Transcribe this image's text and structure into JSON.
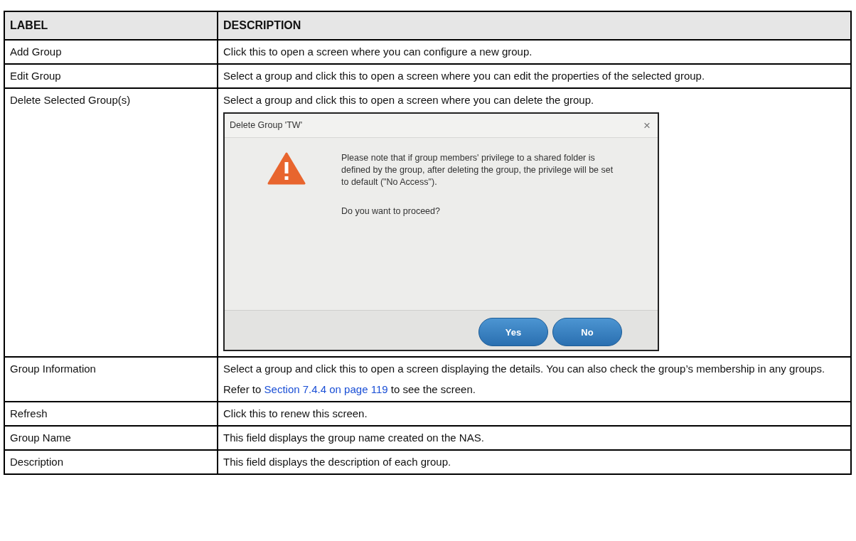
{
  "table": {
    "columns": [
      "LABEL",
      "DESCRIPTION"
    ],
    "rows": [
      {
        "label": "Add Group",
        "paragraphs": [
          {
            "text": "Click this to open a screen where you can configure a new group."
          }
        ]
      },
      {
        "label": "Edit Group",
        "paragraphs": [
          {
            "text": "Select a group and click this to open a screen where you can edit the properties of the selected group."
          }
        ]
      },
      {
        "label": "Delete Selected Group(s)",
        "paragraphs": [
          {
            "text": "Select a group and click this to open a screen where you can delete the group."
          }
        ],
        "dialog": {
          "title": "Delete Group 'TW'",
          "close": "×",
          "message": "Please note that if group members' privilege to a shared folder is defined by the group, after deleting the group, the privilege will be set to default (\"No Access\").",
          "question": "Do you want to proceed?",
          "buttons": [
            "Yes",
            "No"
          ]
        }
      },
      {
        "label": "Group Information",
        "paragraphs": [
          {
            "text": "Select a group and click this to open a screen displaying the details. You can also check the group’s membership in any groups."
          },
          {
            "text": "Refer to ",
            "link": "Section 7.4.4 on page 119",
            "after": " to see the screen."
          }
        ]
      },
      {
        "label": "Refresh",
        "paragraphs": [
          {
            "text": "Click this to renew this screen."
          }
        ]
      },
      {
        "label": "Group Name",
        "paragraphs": [
          {
            "text": "This field displays the group name created on the NAS."
          }
        ]
      },
      {
        "label": "Description",
        "paragraphs": [
          {
            "text": "This field displays the description of each group."
          }
        ]
      }
    ]
  }
}
